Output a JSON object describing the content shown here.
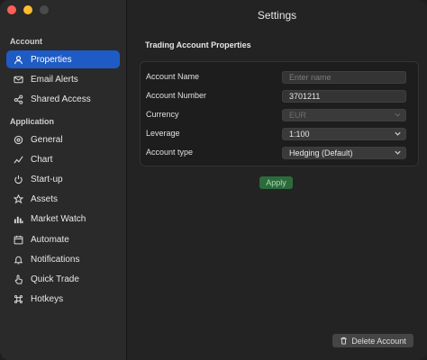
{
  "window": {
    "title": "Settings"
  },
  "sidebar": {
    "sections": [
      {
        "header": "Account",
        "items": [
          {
            "label": "Properties",
            "icon": "person-icon",
            "active": true
          },
          {
            "label": "Email Alerts",
            "icon": "envelope-icon"
          },
          {
            "label": "Shared Access",
            "icon": "share-icon"
          }
        ]
      },
      {
        "header": "Application",
        "items": [
          {
            "label": "General",
            "icon": "gear-icon"
          },
          {
            "label": "Chart",
            "icon": "line-chart-icon"
          },
          {
            "label": "Start-up",
            "icon": "power-icon"
          },
          {
            "label": "Assets",
            "icon": "assets-icon"
          },
          {
            "label": "Market Watch",
            "icon": "bar-chart-icon"
          },
          {
            "label": "Automate",
            "icon": "calendar-icon"
          },
          {
            "label": "Notifications",
            "icon": "bell-icon"
          },
          {
            "label": "Quick Trade",
            "icon": "pointer-icon"
          },
          {
            "label": "Hotkeys",
            "icon": "command-icon"
          }
        ]
      }
    ]
  },
  "main": {
    "section_title": "Trading Account Properties",
    "fields": [
      {
        "label": "Account Name",
        "value": "",
        "placeholder": "Enter name",
        "kind": "text"
      },
      {
        "label": "Account Number",
        "value": "3701211",
        "kind": "text"
      },
      {
        "label": "Currency",
        "value": "EUR",
        "kind": "select",
        "disabled": true
      },
      {
        "label": "Leverage",
        "value": "1:100",
        "kind": "select"
      },
      {
        "label": "Account type",
        "value": "Hedging (Default)",
        "kind": "select"
      }
    ],
    "apply_label": "Apply",
    "delete_label": "Delete Account"
  },
  "colors": {
    "accent": "#1f5bc4",
    "apply_green": "#2b6b3a",
    "traffic_red": "#ff5f57",
    "traffic_yellow": "#febc2e"
  }
}
